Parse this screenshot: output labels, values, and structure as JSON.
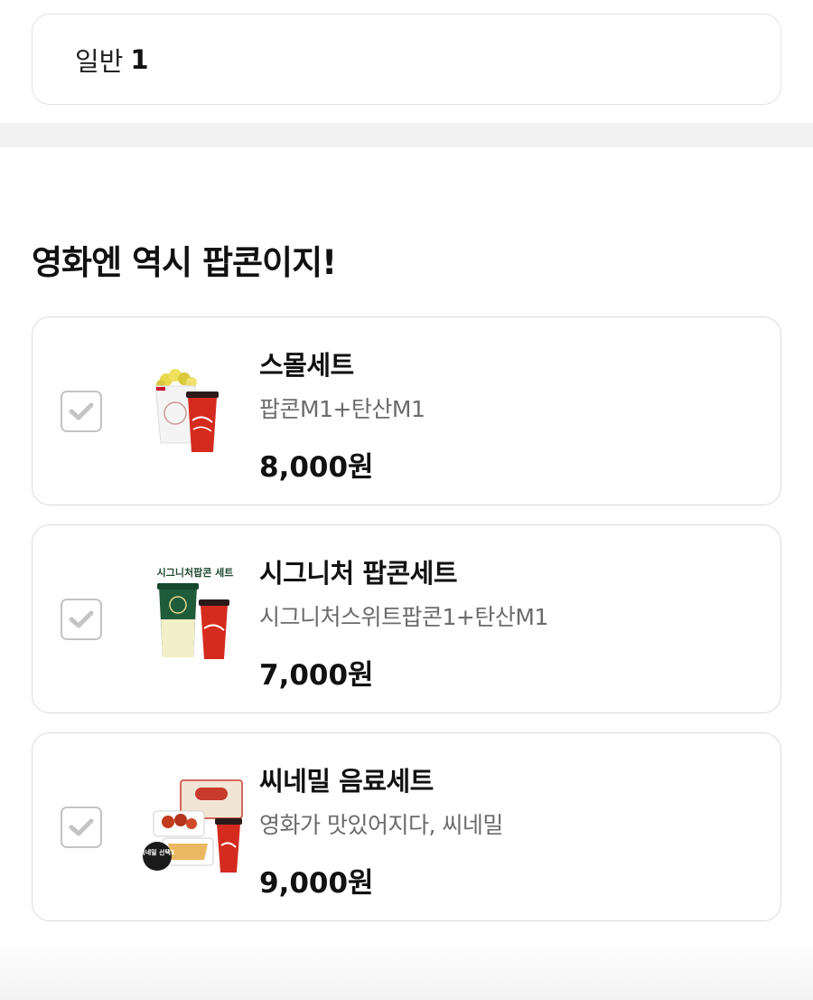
{
  "ticket": {
    "type_label": "일반",
    "count": "1"
  },
  "section": {
    "title": "영화엔 역시 팝콘이지!"
  },
  "combos": [
    {
      "name": "스몰세트",
      "description": "팝콘M1+탄산M1",
      "price": "8,000원",
      "checked": true,
      "thumbnail": "popcorn-and-cola"
    },
    {
      "name": "시그니처 팝콘세트",
      "description": "시그니처스위트팝콘1+탄산M1",
      "price": "7,000원",
      "checked": true,
      "thumbnail_caption": "시그니처팝콘 세트"
    },
    {
      "name": "씨네밀 음료세트",
      "description": "영화가 맛있어지다, 씨네밀",
      "price": "9,000원",
      "checked": true,
      "thumbnail_caption": "씨네밀 선택1"
    }
  ],
  "colors": {
    "check": "#c4c4c4",
    "cola_red": "#d52b1e",
    "border": "#dcdcdc"
  }
}
